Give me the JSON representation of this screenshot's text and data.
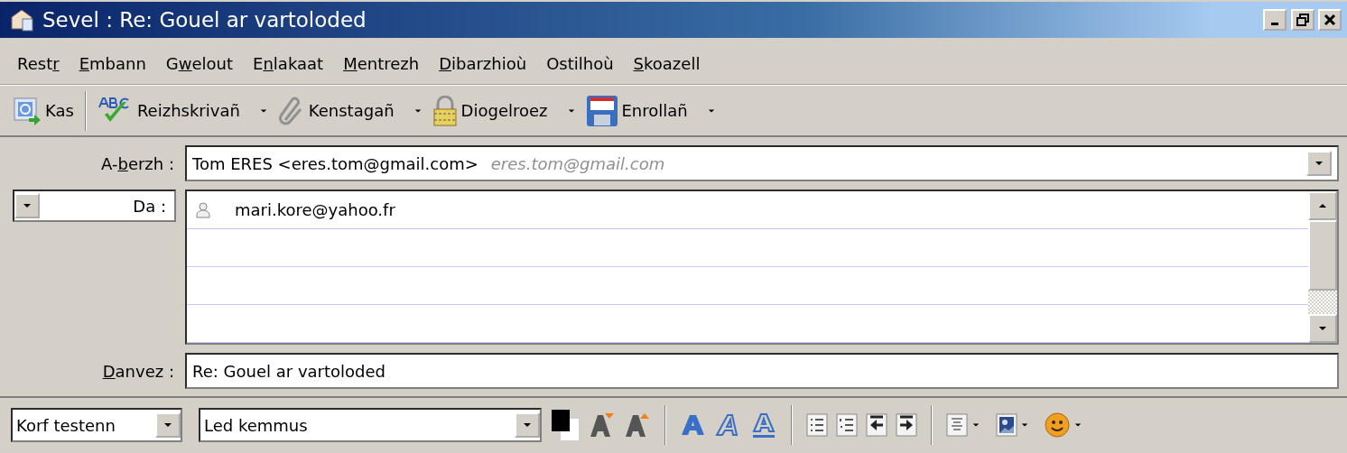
{
  "window": {
    "title": "Sevel : Re: Gouel ar vartoloded"
  },
  "menu": [
    {
      "before": "Rest",
      "key": "r"
    },
    {
      "key": "E",
      "after": "mbann"
    },
    {
      "before": "G",
      "key": "w",
      "after": "elout"
    },
    {
      "before": "E",
      "key": "n",
      "after": "lakaat"
    },
    {
      "key": "M",
      "after": "entrezh"
    },
    {
      "key": "D",
      "after": "ibarzhioù"
    },
    {
      "before": "Ostilhoù"
    },
    {
      "key": "S",
      "after": "koazell"
    }
  ],
  "toolbar": [
    {
      "kind": "send",
      "label": "Kas",
      "dropdown": false
    },
    {
      "kind": "spell",
      "label": "Reizhskrivañ",
      "dropdown": true
    },
    {
      "kind": "attach",
      "label": "Kenstagañ",
      "dropdown": true
    },
    {
      "kind": "security",
      "label": "Diogelroez",
      "dropdown": true
    },
    {
      "kind": "save",
      "label": "Enrollañ",
      "dropdown": true
    }
  ],
  "from": {
    "label": {
      "before": "A-",
      "key": "b",
      "after": "erzh :"
    },
    "value": "Tom ERES <eres.tom@gmail.com>",
    "account_hint": "eres.tom@gmail.com"
  },
  "recipients": {
    "type_label": "Da :",
    "addresses": [
      "mari.kore@yahoo.fr"
    ]
  },
  "subject": {
    "label": {
      "key": "D",
      "after": "anvez :"
    },
    "value": "Re: Gouel ar vartoloded"
  },
  "format_bar": {
    "paragraph_style": "Korf testenn",
    "font": "Led kemmus"
  }
}
